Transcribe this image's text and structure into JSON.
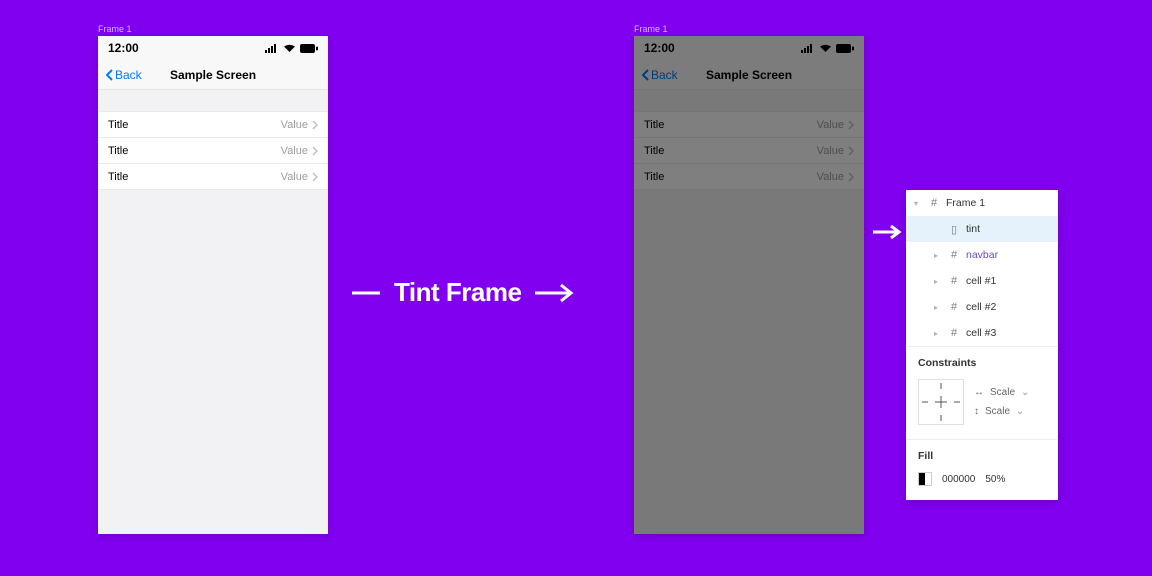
{
  "frame_label": "Frame 1",
  "center_text": "Tint Frame",
  "phone": {
    "time": "12:00",
    "back_label": "Back",
    "title": "Sample Screen",
    "cells": [
      {
        "title": "Title",
        "value": "Value"
      },
      {
        "title": "Title",
        "value": "Value"
      },
      {
        "title": "Title",
        "value": "Value"
      }
    ]
  },
  "panel": {
    "layers": {
      "root": "Frame 1",
      "tint": "tint",
      "navbar": "navbar",
      "cell1": "cell #1",
      "cell2": "cell #2",
      "cell3": "cell #3"
    },
    "constraints_heading": "Constraints",
    "scale_label": "Scale",
    "fill_heading": "Fill",
    "fill_hex": "000000",
    "fill_opacity": "50%"
  }
}
